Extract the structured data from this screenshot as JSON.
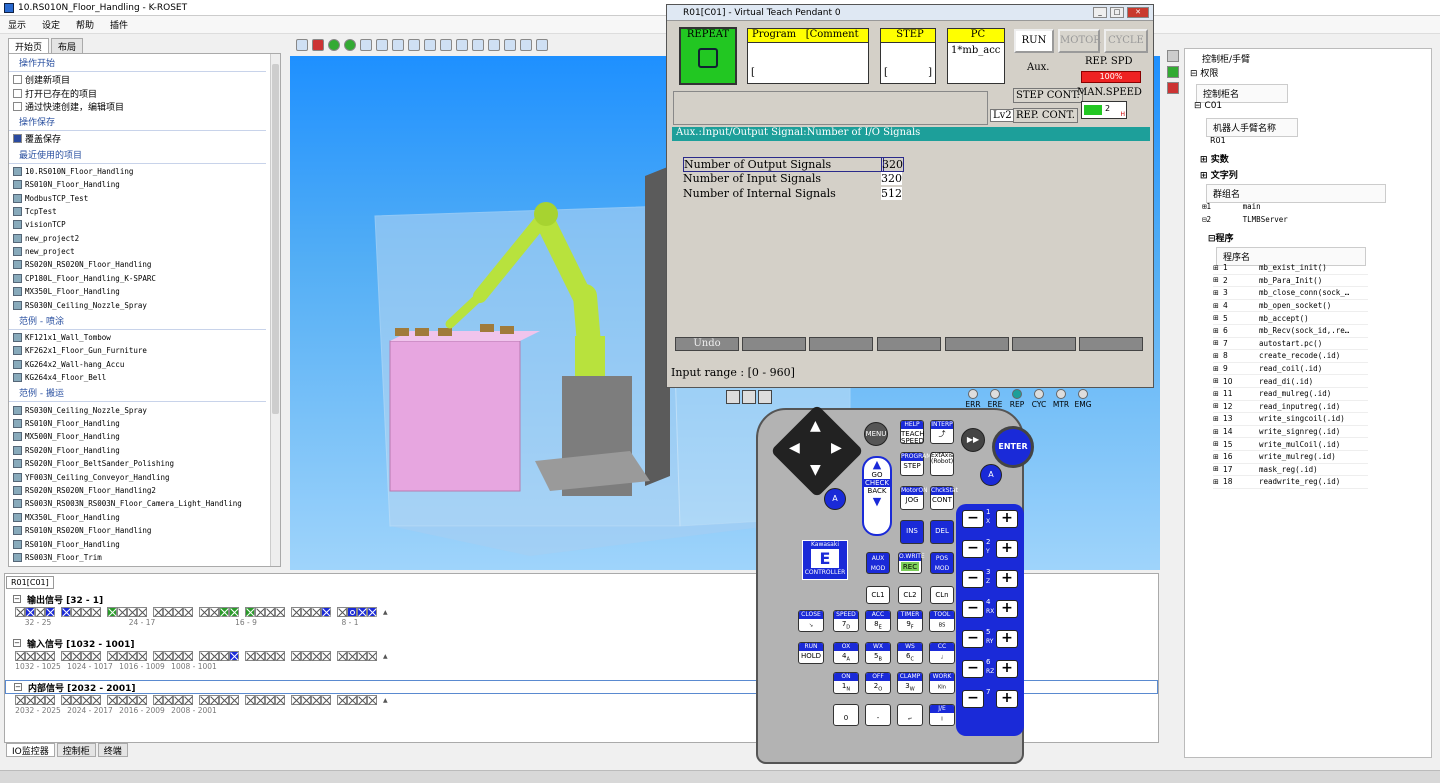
{
  "window": {
    "title": "10.RS010N_Floor_Handling - K-ROSET"
  },
  "menu": [
    "显示",
    "设定",
    "帮助",
    "插件"
  ],
  "left_tabs": [
    "开始页",
    "布局"
  ],
  "left": {
    "sec_start": "操作开始",
    "start_items": [
      "创建新项目",
      "打开已存在的项目",
      "通过快速创建，编辑项目"
    ],
    "sec_save": "操作保存",
    "save_items": [
      "覆盖保存"
    ],
    "sec_recent": "最近使用的项目",
    "recent": [
      "10.RS010N_Floor_Handling",
      "RS010N_Floor_Handling",
      "ModbusTCP_Test",
      "TcpTest",
      "visionTCP",
      "new_project2",
      "new_project",
      "RS020N_RS020N_Floor_Handling",
      "CP180L_Floor_Handling_K-SPARC",
      "MX350L_Floor_Handling",
      "RS030N_Ceiling_Nozzle_Spray"
    ],
    "sec_paint": "范例 - 喷涂",
    "paint": [
      "KF121x1_Wall_Tombow",
      "KF262x1_Floor_Gun_Furniture",
      "KG264x2_Wall-hang_Accu",
      "KG264x4_Floor_Bell"
    ],
    "sec_handling": "范例 - 搬运",
    "handling": [
      "RS030N_Ceiling_Nozzle_Spray",
      "RS010N_Floor_Handling",
      "MX500N_Floor_Handling",
      "RS020N_Floor_Handling",
      "RS020N_Floor_BeltSander_Polishing",
      "YF003N_Ceiling_Conveyor_Handling",
      "RS020N_RS020N_Floor_Handling2",
      "RS003N_RS003N_RS003N_Floor_Camera_Light_Handling",
      "MX350L_Floor_Handling",
      "RS010N_RS020N_Floor_Handling",
      "RS010N_Floor_Handling",
      "RS003N_Floor_Trim"
    ]
  },
  "io": {
    "tab": "R01[C01]",
    "out_title": "输出信号 [32 - 1]",
    "out_axis": [
      "32 - 25",
      "24 - 17",
      "16 - 9",
      "8 - 1"
    ],
    "in_title": "输入信号 [1032 - 1001]",
    "in_axis": [
      "1032 - 1025",
      "1024 - 1017",
      "1016 - 1009",
      "1008 - 1001"
    ],
    "int_title": "内部信号 [2032 - 2001]",
    "int_axis": [
      "2032 - 2025",
      "2024 - 2017",
      "2016 - 2009",
      "2008 - 2001"
    ]
  },
  "bottom_tabs": [
    "IO监控器",
    "控制柜",
    "终端"
  ],
  "tp": {
    "title": "R01[C01] - Virtual Teach Pendant 0",
    "repeat": "REPEAT",
    "program": "Program",
    "comment": "[Comment",
    "program_val": "[",
    "step": "STEP",
    "step_val": "[",
    "step_val_end": "]",
    "pc": "PC",
    "pc_val": "1*mb_acc",
    "run": "RUN",
    "motor": "MOTOR",
    "cycle": "CYCLE",
    "aux": "Aux.",
    "rep_spd": "REP. SPD",
    "rep_spd_val": "100%",
    "step_cont": "STEP CONT.",
    "rep_cont": "REP. CONT.",
    "man_speed": "MAN.SPEED",
    "man_speed_val": "2",
    "man_speed_h": "H",
    "lv": "Lv2",
    "header": "Aux.:Input/Output Signal:Number of I/O Signals",
    "rows": [
      {
        "label": "Number of Output Signals",
        "value": "320"
      },
      {
        "label": "Number of Input Signals",
        "value": "320"
      },
      {
        "label": "Number of Internal Signals",
        "value": "512"
      }
    ],
    "undo": "Undo",
    "input_range": "Input range : [0  - 960]"
  },
  "lamps": [
    "ERR",
    "ERE",
    "REP",
    "CYC",
    "MTR",
    "EMG"
  ],
  "pendant": {
    "menu": "MENU",
    "help": "HELP",
    "teach_speed": "TEACH SPEED",
    "interp": "INTERP",
    "enter": "ENTER",
    "go": "GO",
    "check": "CHECK",
    "back": "BACK",
    "program": "PROGRAM",
    "step": "STEP",
    "ext": "ExtAxis (Robot)",
    "motor_on": "MotorON",
    "jog": "JOG",
    "chk_stat": "ChckStat",
    "cont": "CONT",
    "ins": "INS",
    "del": "DEL",
    "aux": "AUX MOD",
    "owrite": "O.WRITE",
    "rec": "REC",
    "pos": "POS MOD",
    "cl1": "CL1",
    "cl2": "CL2",
    "cln": "CLn",
    "brand1": "Kawasaki",
    "brand2": "E",
    "brand3": "CONTROLLER",
    "a": "A",
    "r": "R",
    "close": "CLOSE",
    "speed": "SPEED",
    "acc": "ACC",
    "timer": "TIMER",
    "tool": "TOOL",
    "run": "RUN",
    "hold": "HOLD",
    "ox": "OX",
    "wx": "WX",
    "ws": "WS",
    "cc": "CC",
    "on": "ON",
    "off": "OFF",
    "clamp": "CLAMP",
    "work": "WORK",
    "je": "J/E",
    "keys": {
      "k7": "7",
      "k8": "8",
      "k9": "9",
      "k4": "4",
      "k5": "5",
      "k6": "6",
      "k1": "1",
      "k2": "2",
      "k3": "3",
      "k0": "0",
      "kdot": ".",
      "kminus": "-"
    },
    "sub": {
      "k7": "D",
      "k8": "E",
      "k9": "F",
      "bs": "BS",
      "k4": "A",
      "k5": "B",
      "k6": "C",
      "k1": "N",
      "k2": "O",
      "k3": "W",
      "kin": "KIn",
      "kI": "I"
    },
    "axes": [
      "1",
      "2",
      "3",
      "4",
      "5",
      "6",
      "7"
    ],
    "axis_sub": [
      "X",
      "Y",
      "Z",
      "RX",
      "RY",
      "RZ",
      ""
    ]
  },
  "right": {
    "tree_title": "控制柜/手臂",
    "auth": "权限",
    "ctrl_name_hdr": "控制柜名",
    "ctrl": "C01",
    "arm_name_hdr": "机器人手臂名称",
    "arm": "R01",
    "real": "实数",
    "string": "文字列",
    "group_hdr": "群组名",
    "groups": [
      {
        "n": "1",
        "name": "main"
      },
      {
        "n": "2",
        "name": "TLMBServer"
      }
    ],
    "program_title": "程序",
    "program_hdr": "程序名",
    "programs": [
      "mb_exist_init()",
      "mb_Para_Init()",
      "mb_close_conn(sock_…",
      "mb_open_socket()",
      "mb_accept()",
      "mb_Recv(sock_id,.re…",
      "autostart.pc()",
      "create_recode(.id)",
      "read_coil(.id)",
      "read_di(.id)",
      "read_mulreg(.id)",
      "read_inputreg(.id)",
      "write_singcoil(.id)",
      "write_signreg(.id)",
      "write_mulCoil(.id)",
      "write_mulreg(.id)",
      "mask_reg(.id)",
      "readwrite_reg(.id)"
    ]
  }
}
